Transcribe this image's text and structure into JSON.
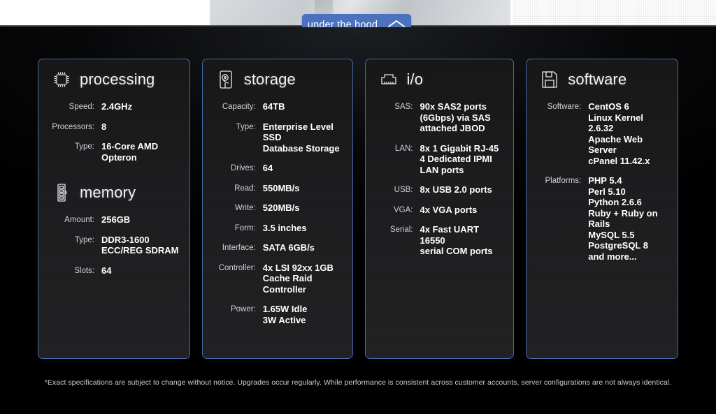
{
  "toggle": {
    "label": "under the hood",
    "icon": "chevron-up-icon",
    "accent_color": "#4a72bf"
  },
  "panels": [
    {
      "key": "processing",
      "sections": [
        {
          "title": "processing",
          "icon": "cpu-chip-icon",
          "specs": [
            {
              "label": "Speed:",
              "value": "2.4GHz"
            },
            {
              "label": "Processors:",
              "value": "8"
            },
            {
              "label": "Type:",
              "value": "16-Core AMD\nOpteron"
            }
          ]
        },
        {
          "title": "memory",
          "icon": "ram-stick-icon",
          "specs": [
            {
              "label": "Amount:",
              "value": "256GB"
            },
            {
              "label": "Type:",
              "value": "DDR3-1600\nECC/REG SDRAM"
            },
            {
              "label": "Slots:",
              "value": "64"
            }
          ]
        }
      ]
    },
    {
      "key": "storage",
      "sections": [
        {
          "title": "storage",
          "icon": "hard-disk-icon",
          "specs": [
            {
              "label": "Capacity:",
              "value": "64TB"
            },
            {
              "label": "Type:",
              "value": "Enterprise Level SSD\nDatabase Storage"
            },
            {
              "label": "Drives:",
              "value": "64"
            },
            {
              "label": "Read:",
              "value": "550MB/s"
            },
            {
              "label": "Write:",
              "value": "520MB/s"
            },
            {
              "label": "Form:",
              "value": "3.5 inches"
            },
            {
              "label": "Interface:",
              "value": "SATA 6GB/s"
            },
            {
              "label": "Controller:",
              "value": "4x LSI 92xx 1GB\nCache Raid\nController"
            },
            {
              "label": "Power:",
              "value": "1.65W Idle\n3W Active"
            }
          ]
        }
      ]
    },
    {
      "key": "io",
      "sections": [
        {
          "title": "i/o",
          "icon": "ethernet-port-icon",
          "specs": [
            {
              "label": "SAS:",
              "value": "90x SAS2 ports\n(6Gbps) via SAS\nattached JBOD"
            },
            {
              "label": "LAN:",
              "value": "8x 1 Gigabit RJ-45\n4 Dedicated IPMI\nLAN ports"
            },
            {
              "label": "USB:",
              "value": "8x USB 2.0 ports"
            },
            {
              "label": "VGA:",
              "value": "4x VGA ports"
            },
            {
              "label": "Serial:",
              "value": "4x Fast UART 16550\nserial COM ports"
            }
          ]
        }
      ]
    },
    {
      "key": "software",
      "sections": [
        {
          "title": "software",
          "icon": "floppy-disk-icon",
          "specs": [
            {
              "label": "Software:",
              "value": "CentOS 6\nLinux Kernel 2.6.32\nApache Web Server\ncPanel 11.42.x"
            },
            {
              "label": "Platforms:",
              "value": "PHP 5.4\nPerl 5.10\nPython 2.6.6\nRuby + Ruby on Rails\nMySQL 5.5\nPostgreSQL 8\nand more..."
            }
          ]
        }
      ]
    }
  ],
  "footnote": "*Exact specifications are subject to change without notice. Upgrades occur regularly. While performance is consistent across customer accounts, server configurations are not always identical."
}
